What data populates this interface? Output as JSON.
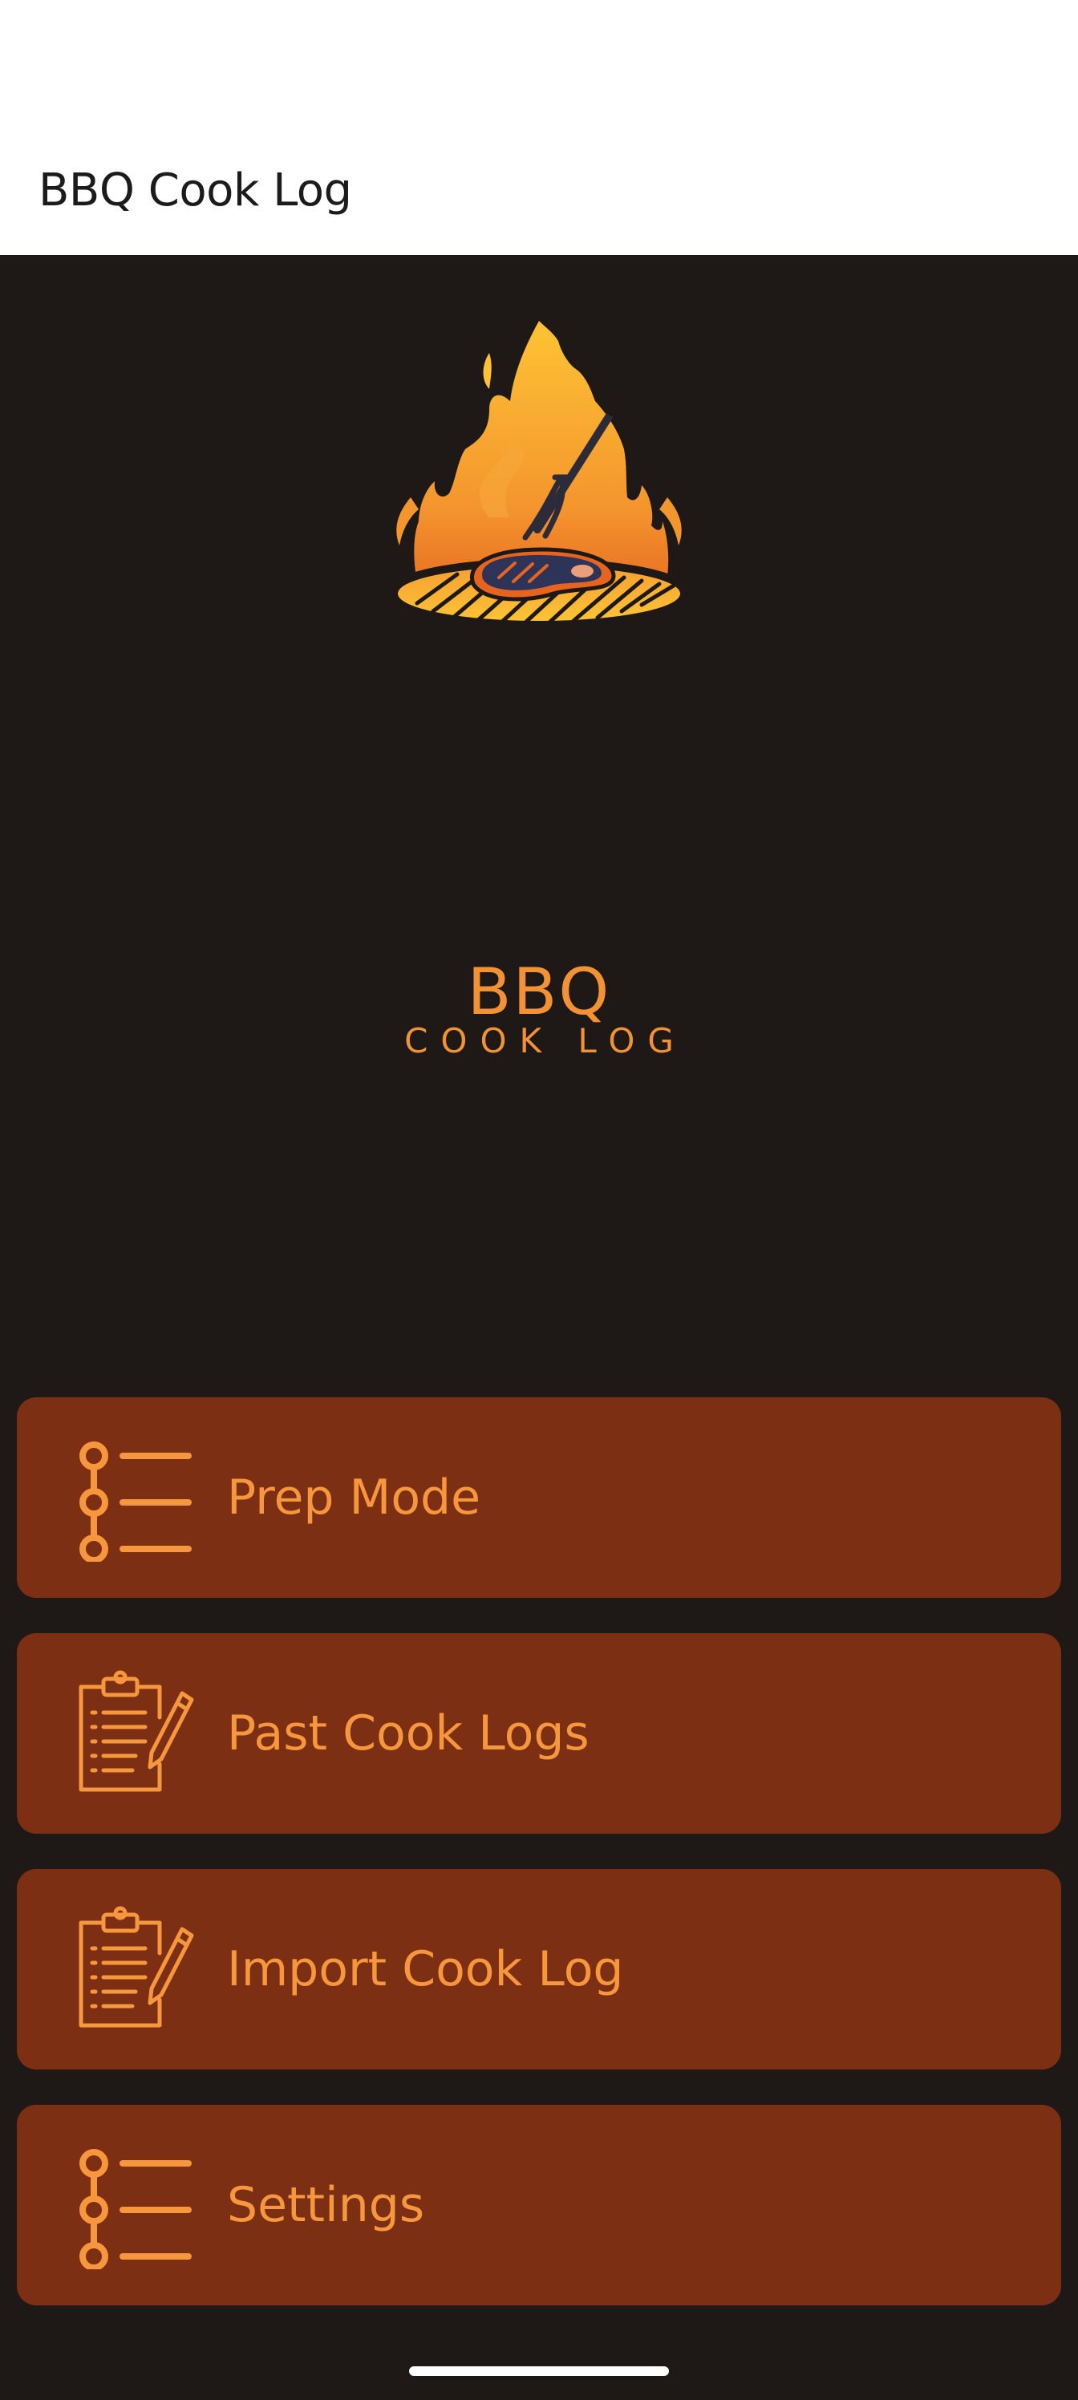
{
  "app_bar": {
    "title": "BBQ Cook Log"
  },
  "logo": {
    "title": "BBQ",
    "subtitle": "COOK LOG",
    "icon": "flame-grill-steak-logo",
    "colors": {
      "flame_top": "#fdc334",
      "flame_bottom": "#e04f1b",
      "steak": "#2e3458",
      "outline": "#1e1916",
      "text": "#f29234"
    }
  },
  "menu": {
    "items": [
      {
        "label": "Prep Mode",
        "icon": "checklist-icon"
      },
      {
        "label": "Past Cook Logs",
        "icon": "clipboard-pencil-icon"
      },
      {
        "label": "Import Cook Log",
        "icon": "clipboard-pencil-icon"
      },
      {
        "label": "Settings",
        "icon": "checklist-icon"
      }
    ]
  },
  "colors": {
    "background": "#1e1916",
    "button": "#7d2f14",
    "accent": "#f7973d",
    "app_bar": "#ffffff"
  }
}
